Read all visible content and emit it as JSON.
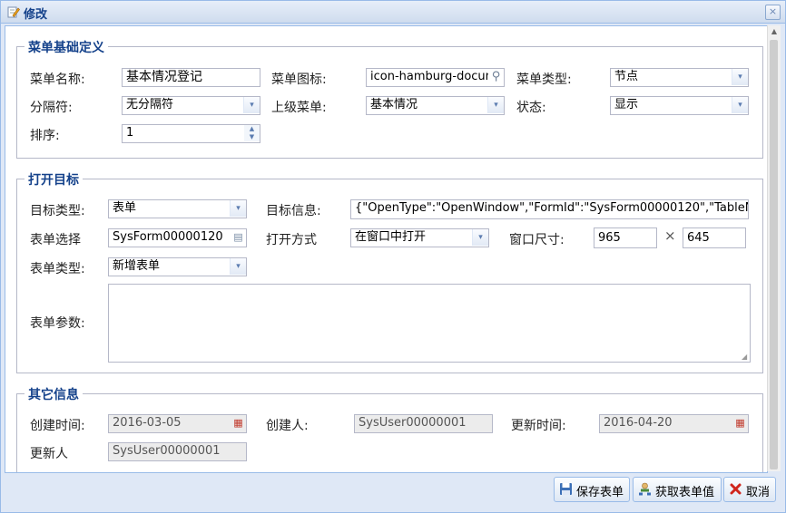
{
  "window": {
    "title": "修改",
    "close": "×"
  },
  "icons": {
    "title": "edit-pencil-icon",
    "close": "close-icon",
    "dropdown": "▾",
    "calendar": "▦",
    "search": "⚲",
    "picker": "▤",
    "spin_up": "▲",
    "spin_down": "▼",
    "save": "floppy-icon",
    "fetch": "user-network-icon",
    "cancel": "red-x-icon"
  },
  "sections": {
    "basic": {
      "legend": "菜单基础定义",
      "menu_name_label": "菜单名称:",
      "menu_name_value": "基本情况登记",
      "menu_icon_label": "菜单图标:",
      "menu_icon_value": "icon-hamburg-docume",
      "menu_type_label": "菜单类型:",
      "menu_type_value": "节点",
      "separator_label": "分隔符:",
      "separator_value": "无分隔符",
      "parent_label": "上级菜单:",
      "parent_value": "基本情况",
      "status_label": "状态:",
      "status_value": "显示",
      "sort_label": "排序:",
      "sort_value": "1"
    },
    "target": {
      "legend": "打开目标",
      "target_type_label": "目标类型:",
      "target_type_value": "表单",
      "target_info_label": "目标信息:",
      "target_info_value": "{\"OpenType\":\"OpenWindow\",\"FormId\":\"SysForm00000120\",\"TableNa",
      "form_select_label": "表单选择",
      "form_select_value": "SysForm00000120",
      "open_mode_label": "打开方式",
      "open_mode_value": "在窗口中打开",
      "window_size_label": "窗口尺寸:",
      "window_width": "965",
      "times": "×",
      "window_height": "645",
      "form_type_label": "表单类型:",
      "form_type_value": "新增表单",
      "form_params_label": "表单参数:",
      "form_params_value": ""
    },
    "other": {
      "legend": "其它信息",
      "created_time_label": "创建时间:",
      "created_time_value": "2016-03-05",
      "creator_label": "创建人:",
      "creator_value": "SysUser00000001",
      "updated_time_label": "更新时间:",
      "updated_time_value": "2016-04-20",
      "updater_label": "更新人",
      "updater_value": "SysUser00000001"
    }
  },
  "buttons": {
    "save": "保存表单",
    "fetch": "获取表单值",
    "cancel": "取消"
  },
  "colors": {
    "border": "#99bbe8",
    "header_text": "#15428b",
    "window_bg": "#dfe8f6"
  }
}
